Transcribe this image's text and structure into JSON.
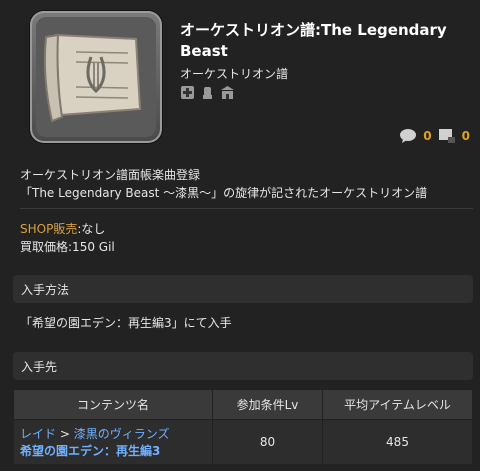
{
  "item": {
    "title": "オーケストリオン譜:The Legendary Beast",
    "category": "オーケストリオン譜",
    "icon": "orchestrion-scroll-icon"
  },
  "flags": [
    "plus-shield-icon",
    "hand-icon",
    "market-icon"
  ],
  "counts": {
    "comments": "0",
    "images": "0"
  },
  "description": {
    "line1": "オーケストリオン譜面帳楽曲登録",
    "line2": "「The Legendary Beast ～漆黒～」の旋律が記されたオーケストリオン譜"
  },
  "shop": {
    "label": "SHOP販売",
    "value": ":なし",
    "sell_label": "買取価格",
    "sell_value": ":150 Gil"
  },
  "sections": {
    "obtain_heading": "入手方法",
    "obtain_text": "「希望の園エデン：再生編3」にて入手",
    "source_heading": "入手先"
  },
  "table": {
    "headers": [
      "コンテンツ名",
      "参加条件Lv",
      "平均アイテムレベル"
    ],
    "row": {
      "crumb_1": "レイド",
      "separator": ">",
      "crumb_2": "漆黒のヴィランズ",
      "name": "希望の園エデン：再生編3",
      "level": "80",
      "ilvl": "485"
    }
  },
  "colors": {
    "accent": "#e0a020",
    "link": "#6fb0ff",
    "shop_key": "#d8a040"
  }
}
